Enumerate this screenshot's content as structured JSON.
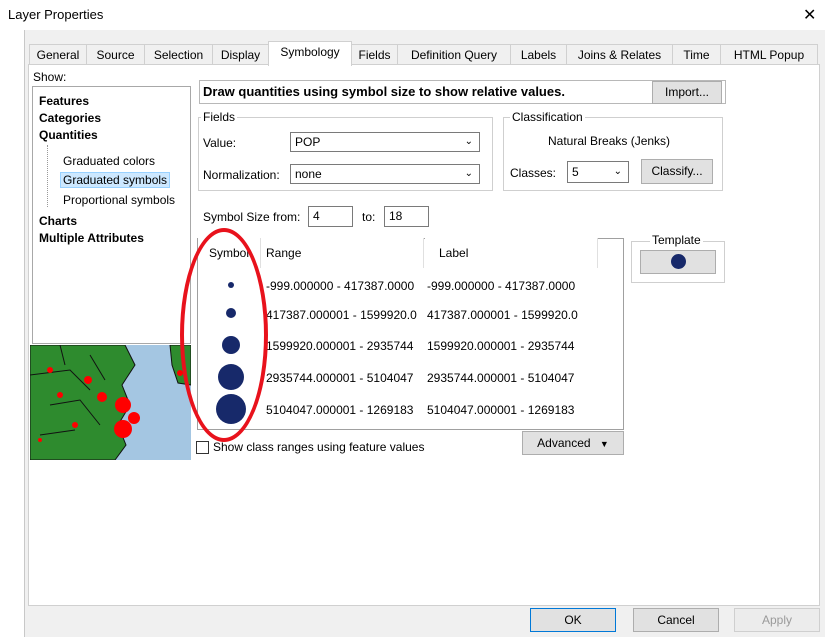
{
  "window": {
    "title": "Layer Properties",
    "close_glyph": "✕"
  },
  "tabs": [
    "General",
    "Source",
    "Selection",
    "Display",
    "Symbology",
    "Fields",
    "Definition Query",
    "Labels",
    "Joins & Relates",
    "Time",
    "HTML Popup"
  ],
  "show": {
    "label": "Show:",
    "items": [
      {
        "label": "Features",
        "bold": true
      },
      {
        "label": "Categories",
        "bold": true
      },
      {
        "label": "Quantities",
        "bold": true
      },
      {
        "label": "Graduated colors",
        "bold": false
      },
      {
        "label": "Graduated symbols",
        "bold": false
      },
      {
        "label": "Proportional symbols",
        "bold": false
      },
      {
        "label": "Charts",
        "bold": true
      },
      {
        "label": "Multiple Attributes",
        "bold": true
      }
    ]
  },
  "description": "Draw quantities using symbol size to show relative values.",
  "import_label": "Import...",
  "fields": {
    "group_label": "Fields",
    "value_label": "Value:",
    "value": "POP",
    "normalization_label": "Normalization:",
    "normalization": "none"
  },
  "classification": {
    "group_label": "Classification",
    "method": "Natural Breaks (Jenks)",
    "classes_label": "Classes:",
    "classes": "5",
    "classify_label": "Classify..."
  },
  "symbol_size": {
    "from_label": "Symbol Size from:",
    "from": "4",
    "to_label": "to:",
    "to": "18"
  },
  "template": {
    "label": "Template",
    "color": "#17296a"
  },
  "table": {
    "headers": [
      "Symbol",
      "Range",
      "Label"
    ],
    "rows": [
      {
        "range": "-999.000000 - 417387.0000",
        "label": "-999.000000 - 417387.0000"
      },
      {
        "range": "417387.000001 - 1599920.0",
        "label": "417387.000001 - 1599920.0"
      },
      {
        "range": "1599920.000001 - 2935744",
        "label": "1599920.000001 - 2935744"
      },
      {
        "range": "2935744.000001 - 5104047",
        "label": "2935744.000001 - 5104047"
      },
      {
        "range": "5104047.000001 - 1269183",
        "label": "5104047.000001 - 1269183"
      }
    ]
  },
  "show_class_ranges": {
    "label": "Show class ranges using feature values",
    "checked": false
  },
  "advanced_label": "Advanced",
  "buttons": {
    "ok": "OK",
    "cancel": "Cancel",
    "apply": "Apply"
  },
  "colors": {
    "symbol_fill": "#17296a",
    "annotation_ellipse": "#e8121c",
    "map_water": "#a4c6e2",
    "map_land": "#2e8b2e",
    "map_points": "#ff0000"
  }
}
